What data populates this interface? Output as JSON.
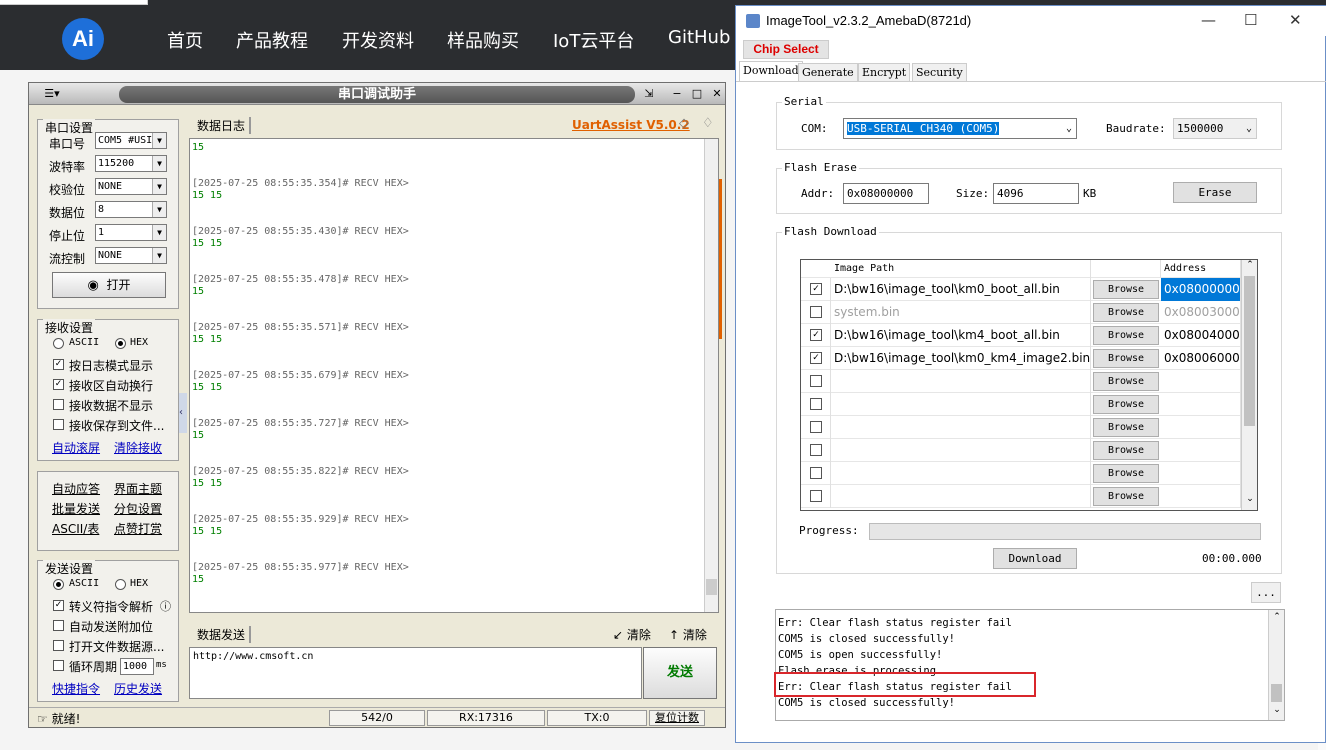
{
  "site": {
    "logo_text": "Ai",
    "nav": [
      "首页",
      "产品教程",
      "开发资料",
      "样品购买",
      "IoT云平台",
      "GitHub"
    ]
  },
  "uart": {
    "title": "串口调试助手",
    "serial_settings": {
      "title": "串口设置",
      "port_label": "串口号",
      "port_value": "COM5 #USI",
      "baud_label": "波特率",
      "baud_value": "115200",
      "parity_label": "校验位",
      "parity_value": "NONE",
      "databits_label": "数据位",
      "databits_value": "8",
      "stopbits_label": "停止位",
      "stopbits_value": "1",
      "flow_label": "流控制",
      "flow_value": "NONE",
      "open_button": "打开"
    },
    "recv_settings": {
      "title": "接收设置",
      "ascii": "ASCII",
      "hex": "HEX",
      "opt1": "按日志模式显示",
      "opt2": "接收区自动换行",
      "opt3": "接收数据不显示",
      "opt4": "接收保存到文件...",
      "link1": "自动滚屏",
      "link2": "清除接收"
    },
    "tools": {
      "l1": "自动应答",
      "l2": "界面主题",
      "l3": "批量发送",
      "l4": "分包设置",
      "l5": "ASCII/表",
      "l6": "点赞打赏"
    },
    "send_settings": {
      "title": "发送设置",
      "ascii": "ASCII",
      "hex": "HEX",
      "opt1": "转义符指令解析",
      "opt2": "自动发送附加位",
      "opt3": "打开文件数据源...",
      "opt4": "循环周期",
      "period": "1000",
      "unit": "ms",
      "link1": "快捷指令",
      "link2": "历史发送"
    },
    "log_tab": "数据日志",
    "brand": "UartAssist V5.0.2",
    "log": [
      {
        "ts": "",
        "data": "15"
      },
      {
        "ts": "[2025-07-25 08:55:35.354]# RECV HEX>",
        "data": "15 15"
      },
      {
        "ts": "[2025-07-25 08:55:35.430]# RECV HEX>",
        "data": "15 15"
      },
      {
        "ts": "[2025-07-25 08:55:35.478]# RECV HEX>",
        "data": "15"
      },
      {
        "ts": "[2025-07-25 08:55:35.571]# RECV HEX>",
        "data": "15 15"
      },
      {
        "ts": "[2025-07-25 08:55:35.679]# RECV HEX>",
        "data": "15 15"
      },
      {
        "ts": "[2025-07-25 08:55:35.727]# RECV HEX>",
        "data": "15"
      },
      {
        "ts": "[2025-07-25 08:55:35.822]# RECV HEX>",
        "data": "15 15"
      },
      {
        "ts": "[2025-07-25 08:55:35.929]# RECV HEX>",
        "data": "15 15"
      },
      {
        "ts": "[2025-07-25 08:55:35.977]# RECV HEX>",
        "data": "15"
      }
    ],
    "send_tab": "数据发送",
    "clear1": "清除",
    "clear2": "清除",
    "send_text": "http://www.cmsoft.cn",
    "send_button": "发送",
    "status": {
      "ready": "就绪!",
      "count": "542/0",
      "rx": "RX:17316",
      "tx": "TX:0",
      "reset": "复位计数"
    }
  },
  "imagetool": {
    "title": "ImageTool_v2.3.2_AmebaD(8721d)",
    "chip_select": "Chip Select",
    "tabs": [
      "Download",
      "Generate",
      "Encrypt",
      "Security"
    ],
    "serial": {
      "title": "Serial",
      "com_label": "COM:",
      "com_value": "USB-SERIAL CH340 (COM5)",
      "baud_label": "Baudrate:",
      "baud_value": "1500000"
    },
    "erase": {
      "title": "Flash Erase",
      "addr_label": "Addr:",
      "addr_value": "0x08000000",
      "size_label": "Size:",
      "size_value": "4096",
      "unit": "KB",
      "button": "Erase"
    },
    "download": {
      "title": "Flash Download",
      "col_path": "Image Path",
      "col_addr": "Address",
      "browse": "Browse",
      "rows": [
        {
          "checked": true,
          "path": "D:\\bw16\\image_tool\\km0_boot_all.bin",
          "addr": "0x08000000",
          "dim": false,
          "selected": true
        },
        {
          "checked": false,
          "path": "system.bin",
          "addr": "0x08003000",
          "dim": true,
          "selected": false
        },
        {
          "checked": true,
          "path": "D:\\bw16\\image_tool\\km4_boot_all.bin",
          "addr": "0x08004000",
          "dim": false,
          "selected": false
        },
        {
          "checked": true,
          "path": "D:\\bw16\\image_tool\\km0_km4_image2.bin",
          "addr": "0x08006000",
          "dim": false,
          "selected": false
        },
        {
          "checked": false,
          "path": "",
          "addr": "",
          "dim": false,
          "selected": false
        },
        {
          "checked": false,
          "path": "",
          "addr": "",
          "dim": false,
          "selected": false
        },
        {
          "checked": false,
          "path": "",
          "addr": "",
          "dim": false,
          "selected": false
        },
        {
          "checked": false,
          "path": "",
          "addr": "",
          "dim": false,
          "selected": false
        },
        {
          "checked": false,
          "path": "",
          "addr": "",
          "dim": false,
          "selected": false
        },
        {
          "checked": false,
          "path": "",
          "addr": "",
          "dim": false,
          "selected": false
        }
      ],
      "progress_label": "Progress:",
      "progress_value": 0,
      "button": "Download",
      "time": "00:00.000"
    },
    "more_button": "...",
    "log": [
      "Err: Clear flash status register fail",
      "COM5 is closed successfully!",
      "COM5 is open successfully!",
      "Flash erase is processing...",
      "Err: Clear flash status register fail",
      "COM5 is closed successfully!"
    ],
    "highlight_color": "#d9262b",
    "selected_color": "#0078d7"
  }
}
